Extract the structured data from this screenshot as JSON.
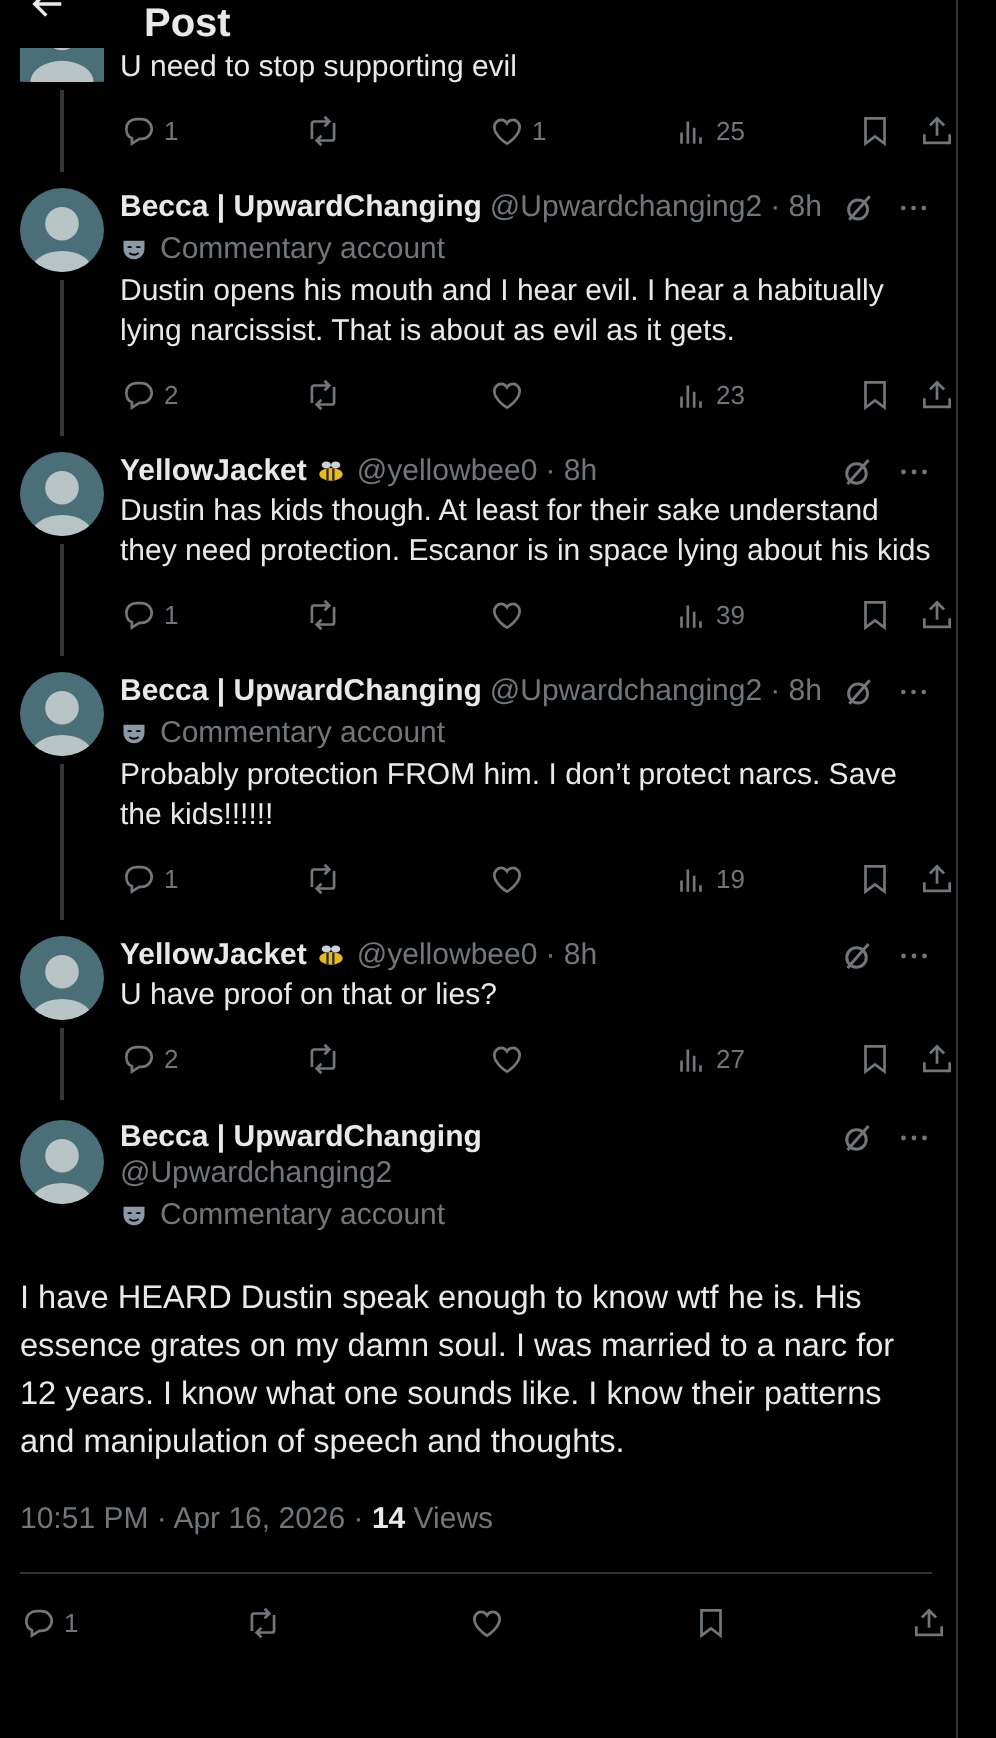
{
  "header": {
    "title": "Post"
  },
  "replies": [
    {
      "text": "U need to stop supporting evil",
      "stats": {
        "replies": "1",
        "likes": "1",
        "views": "25"
      }
    },
    {
      "name": "Becca | UpwardChanging",
      "badge": false,
      "handle": "@Upwardchanging2",
      "time": "· 8h",
      "label": "Commentary account",
      "text": "Dustin opens his mouth and I hear evil. I hear a habitually lying narcissist. That is about as evil as it gets.",
      "stats": {
        "replies": "2",
        "views": "23"
      }
    },
    {
      "name": "YellowJacket",
      "badge": true,
      "handle": "@yellowbee0",
      "time": "· 8h",
      "text": "Dustin has kids though. At least for their sake understand they need protection. Escanor is in space lying about his kids",
      "stats": {
        "replies": "1",
        "views": "39"
      }
    },
    {
      "name": "Becca | UpwardChanging",
      "badge": false,
      "handle": "@Upwardchanging2",
      "time": "· 8h",
      "label": "Commentary account",
      "text": "Probably protection FROM him. I don’t protect narcs. Save the kids!!!!!!",
      "stats": {
        "replies": "1",
        "views": "19"
      }
    },
    {
      "name": "YellowJacket",
      "badge": true,
      "handle": "@yellowbee0",
      "time": "· 8h",
      "text": "U have proof on that or lies?",
      "stats": {
        "replies": "2",
        "views": "27"
      }
    }
  ],
  "main_post": {
    "name": "Becca | UpwardChanging",
    "handle": "@Upwardchanging2",
    "label": "Commentary account",
    "text": "I have HEARD Dustin speak enough to know wtf he is. His essence grates on my damn soul. I was married to a narc for 12 years. I know what one sounds like. I know their patterns and manipulation of speech and thoughts.",
    "meta": "10:51 PM · Apr 16, 2026 · **14** Views",
    "stats": {
      "replies": "1"
    }
  }
}
